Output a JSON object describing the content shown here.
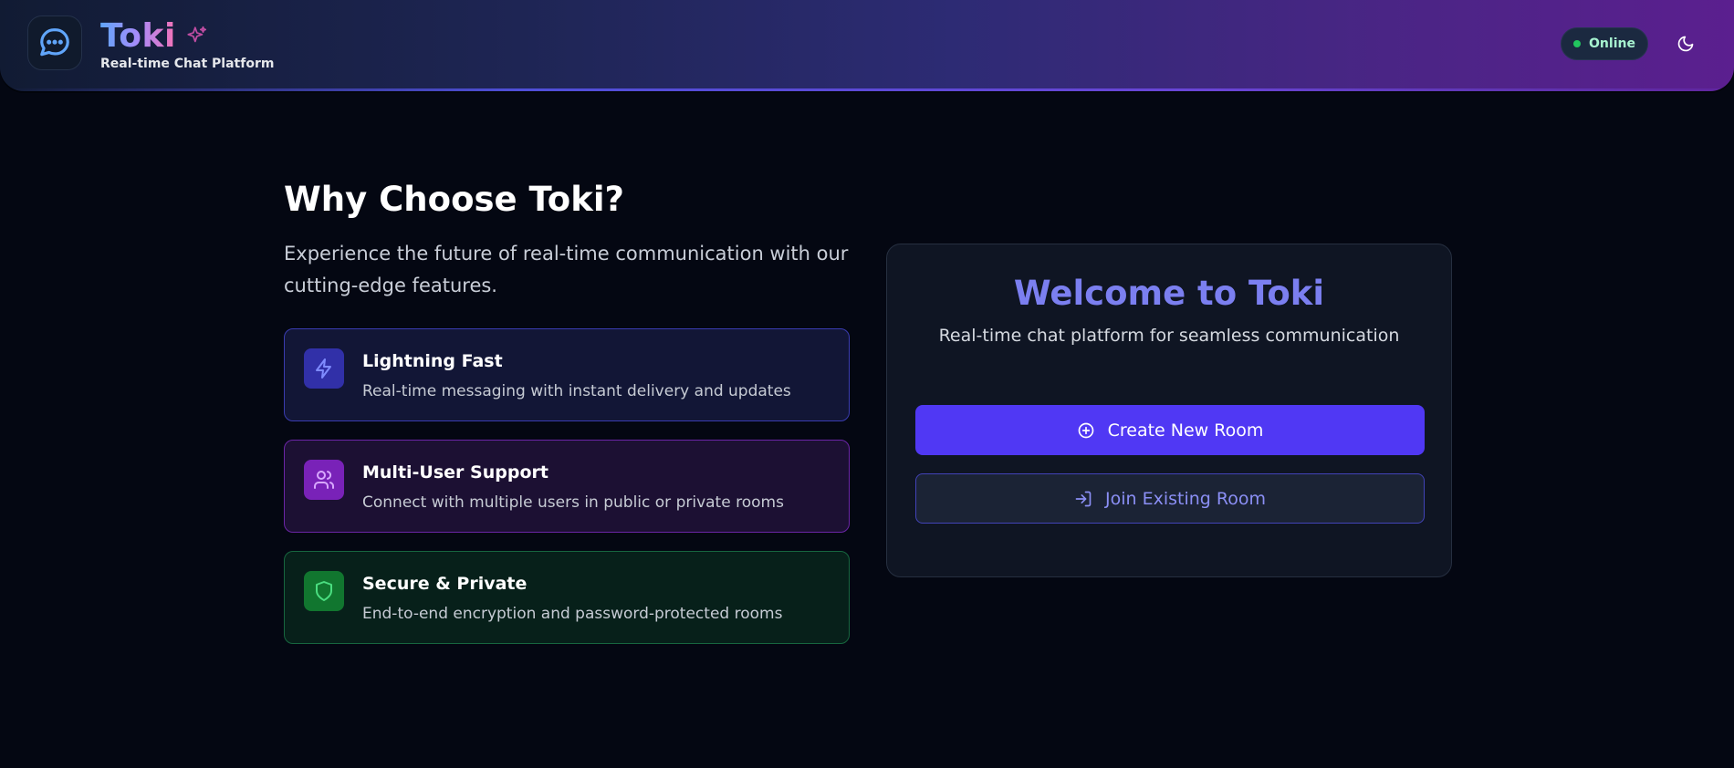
{
  "header": {
    "brand": "Toki",
    "tagline": "Real-time Chat Platform",
    "status_label": "Online",
    "icons": {
      "logo": "chat-bubble-icon",
      "sparkle": "sparkles-icon",
      "theme": "moon-icon"
    }
  },
  "features_section": {
    "title": "Why Choose Toki?",
    "description": "Experience the future of real-time communication with our cutting-edge features.",
    "items": [
      {
        "title": "Lightning Fast",
        "description": "Real-time messaging with instant delivery and updates",
        "icon": "lightning-icon",
        "accent": "#3130a8"
      },
      {
        "title": "Multi-User Support",
        "description": "Connect with multiple users in public or private rooms",
        "icon": "users-icon",
        "accent": "#7922b8"
      },
      {
        "title": "Secure & Private",
        "description": "End-to-end encryption and password-protected rooms",
        "icon": "shield-icon",
        "accent": "#11762f"
      }
    ]
  },
  "welcome_card": {
    "title": "Welcome to Toki",
    "subtitle": "Real-time chat platform for seamless communication",
    "create_label": "Create New Room",
    "join_label": "Join Existing Room",
    "icons": {
      "create": "plus-circle-icon",
      "join": "log-in-icon"
    }
  },
  "colors": {
    "primary": "#5038f4",
    "accent_text": "#7b7ff0",
    "online": "#22c55e",
    "background": "#040712"
  }
}
